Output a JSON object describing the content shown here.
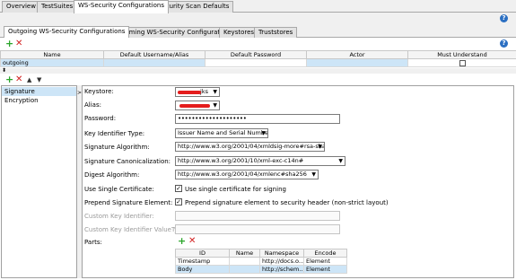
{
  "tabs": [
    "Overview",
    "TestSuites",
    "WS-Security Configurations",
    "Security Scan Defaults"
  ],
  "subtabs": [
    "Outgoing WS-Security Configurations",
    "Incoming WS-Security Configurations",
    "Keystores",
    "Truststores"
  ],
  "help_glyph": "?",
  "icons": {
    "add": "+",
    "remove": "✕",
    "up": "▲",
    "down": "▼",
    "split": "⬍"
  },
  "outgoing_table": {
    "columns": [
      "Name",
      "Default Username/Alias",
      "Default Password",
      "Actor",
      "Must Understand"
    ],
    "rows": [
      {
        "name": "outgoing",
        "username": "",
        "password": "",
        "actor": "",
        "must_understand": false
      }
    ]
  },
  "entries": [
    "Signature",
    "Encryption"
  ],
  "form": {
    "keystore_label": "Keystore:",
    "keystore_value": "jks",
    "alias_label": "Alias:",
    "password_label": "Password:",
    "password_value": "••••••••••••••••••••",
    "key_identifier_label": "Key Identifier Type:",
    "key_identifier_value": "Issuer Name and Serial Number",
    "sig_alg_label": "Signature Algorithm:",
    "sig_alg_value": "http://www.w3.org/2001/04/xmldsig-more#rsa-sha256",
    "sig_canon_label": "Signature Canonicalization:",
    "sig_canon_value": "http://www.w3.org/2001/10/xml-exc-c14n#",
    "digest_label": "Digest Algorithm:",
    "digest_value": "http://www.w3.org/2001/04/xmlenc#sha256",
    "single_cert_label": "Use Single Certificate:",
    "single_cert_text": "Use single certificate for signing",
    "single_cert_checked": true,
    "prepend_label": "Prepend Signature Element:",
    "prepend_text": "Prepend signature element to security header (non-strict layout)",
    "prepend_checked": true,
    "custom_key_label": "Custom Key Identifier:",
    "custom_key_value_label": "Custom Key Identifier ValueType:",
    "parts_label": "Parts:"
  },
  "parts_table": {
    "columns": [
      "ID",
      "Name",
      "Namespace",
      "Encode"
    ],
    "rows": [
      {
        "id": "Timestamp",
        "name": "",
        "namespace": "http://docs.o...",
        "encode": "Element"
      },
      {
        "id": "Body",
        "name": "",
        "namespace": "http://schem...",
        "encode": "Element"
      }
    ]
  },
  "colors": {
    "selected": "#cde5f7",
    "add_green": "#2aa52a",
    "remove_red": "#d21e1e",
    "redaction": "#e41c1c",
    "help_blue": "#2b6fc2"
  }
}
